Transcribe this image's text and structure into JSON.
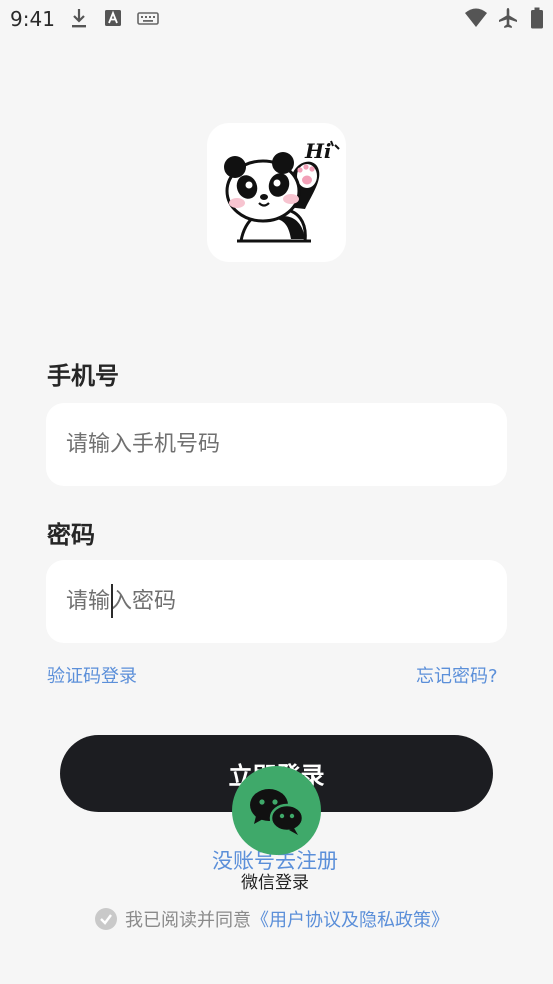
{
  "status_bar": {
    "time": "9:41",
    "left_icons": [
      "download-icon",
      "a-badge-icon",
      "keyboard-icon"
    ],
    "right_icons": [
      "wifi-icon",
      "airplane-icon",
      "battery-icon"
    ]
  },
  "logo": {
    "icon": "panda-hi-icon",
    "text": "Hi"
  },
  "phone": {
    "label": "手机号",
    "placeholder": "请输入手机号码"
  },
  "password": {
    "label": "密码",
    "placeholder": "请输入密码"
  },
  "links": {
    "code_login": "验证码登录",
    "forgot": "忘记密码?"
  },
  "login_button": "立即登录",
  "register_link": "没账号去注册",
  "wechat": {
    "icon": "wechat-icon",
    "label": "微信登录"
  },
  "agreement": {
    "prefix": "我已阅读并同意",
    "link": "《用户协议及隐私政策》",
    "checked": true
  },
  "colors": {
    "accent_link": "#5b8fd9",
    "button": "#1c1d21",
    "wechat_green": "#3fa96a",
    "background": "#f6f6f6"
  }
}
